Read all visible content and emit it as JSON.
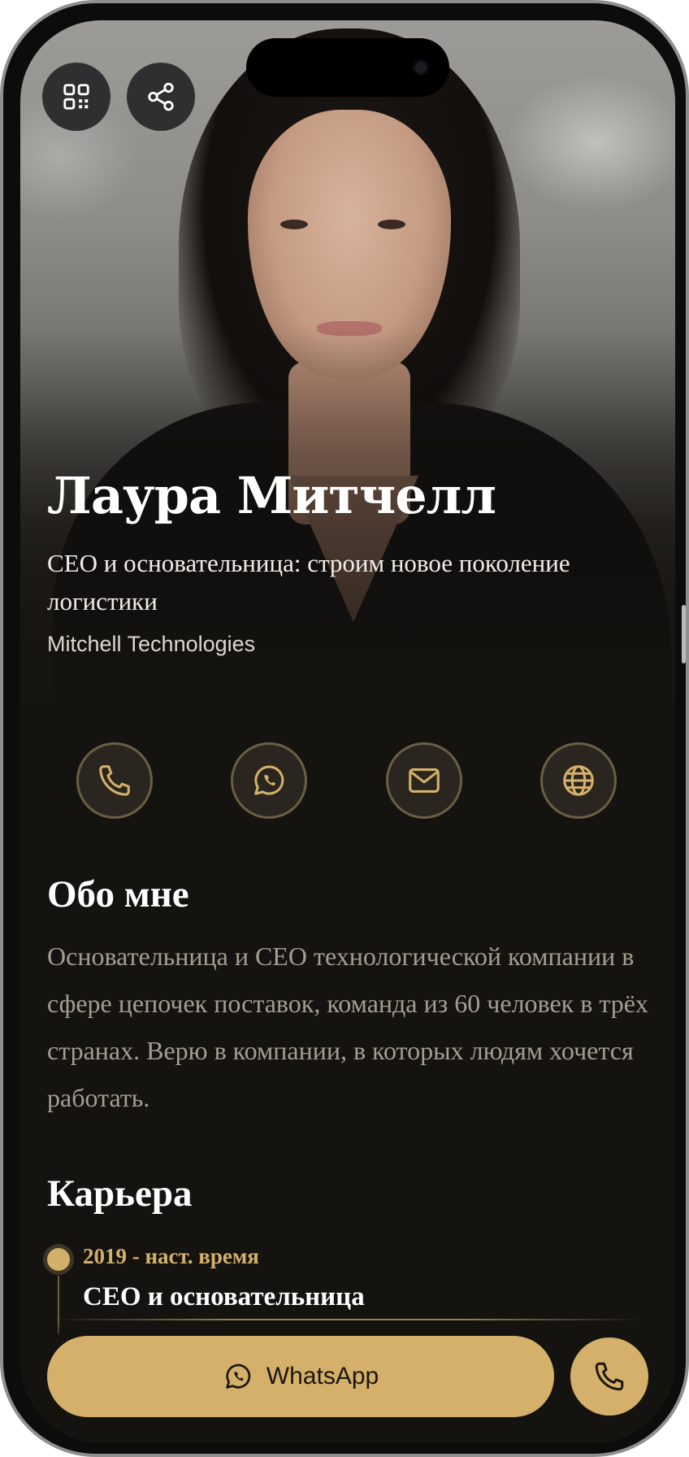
{
  "profile": {
    "name": "Лаура Митчелл",
    "headline": "CEO и основательница: строим новое поколение логистики",
    "company": "Mitchell Technologies"
  },
  "header_actions": [
    {
      "icon": "qr-code-icon"
    },
    {
      "icon": "share-icon"
    }
  ],
  "contact_actions": [
    {
      "icon": "phone-icon"
    },
    {
      "icon": "whatsapp-icon"
    },
    {
      "icon": "mail-icon"
    },
    {
      "icon": "globe-icon"
    }
  ],
  "about": {
    "title": "Обо мне",
    "text": "Основательница и CEO технологической компании в сфере цепочек поставок, команда из 60 человек в трёх странах. Верю в компании, в которых людям хочется работать."
  },
  "career": {
    "title": "Карьера",
    "items": [
      {
        "period": "2019 - наст. время",
        "role": "CEO и основательница"
      }
    ]
  },
  "bottom_bar": {
    "whatsapp_label": "WhatsApp",
    "call_icon": "phone-icon"
  },
  "colors": {
    "accent": "#d4b06a",
    "background": "#15130f",
    "text_muted": "#a39e93"
  }
}
